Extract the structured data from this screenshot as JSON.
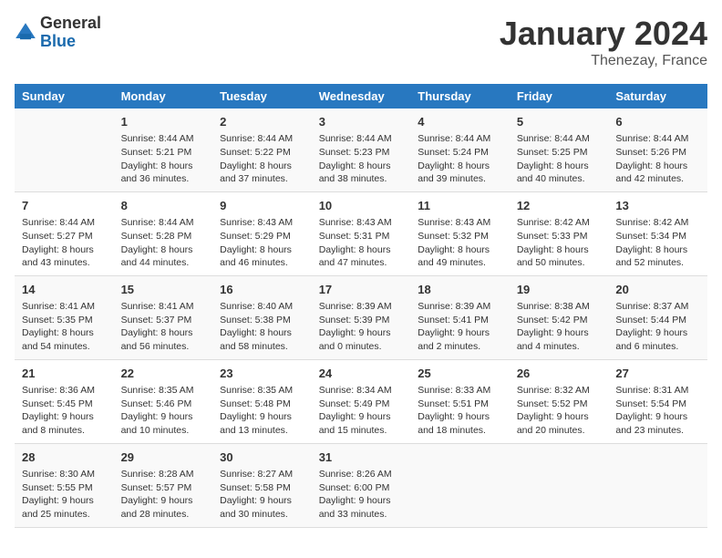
{
  "header": {
    "logo_general": "General",
    "logo_blue": "Blue",
    "month_title": "January 2024",
    "location": "Thenezay, France"
  },
  "weekdays": [
    "Sunday",
    "Monday",
    "Tuesday",
    "Wednesday",
    "Thursday",
    "Friday",
    "Saturday"
  ],
  "weeks": [
    [
      {
        "day": "",
        "sunrise": "",
        "sunset": "",
        "daylight": ""
      },
      {
        "day": "1",
        "sunrise": "Sunrise: 8:44 AM",
        "sunset": "Sunset: 5:21 PM",
        "daylight": "Daylight: 8 hours and 36 minutes."
      },
      {
        "day": "2",
        "sunrise": "Sunrise: 8:44 AM",
        "sunset": "Sunset: 5:22 PM",
        "daylight": "Daylight: 8 hours and 37 minutes."
      },
      {
        "day": "3",
        "sunrise": "Sunrise: 8:44 AM",
        "sunset": "Sunset: 5:23 PM",
        "daylight": "Daylight: 8 hours and 38 minutes."
      },
      {
        "day": "4",
        "sunrise": "Sunrise: 8:44 AM",
        "sunset": "Sunset: 5:24 PM",
        "daylight": "Daylight: 8 hours and 39 minutes."
      },
      {
        "day": "5",
        "sunrise": "Sunrise: 8:44 AM",
        "sunset": "Sunset: 5:25 PM",
        "daylight": "Daylight: 8 hours and 40 minutes."
      },
      {
        "day": "6",
        "sunrise": "Sunrise: 8:44 AM",
        "sunset": "Sunset: 5:26 PM",
        "daylight": "Daylight: 8 hours and 42 minutes."
      }
    ],
    [
      {
        "day": "7",
        "sunrise": "Sunrise: 8:44 AM",
        "sunset": "Sunset: 5:27 PM",
        "daylight": "Daylight: 8 hours and 43 minutes."
      },
      {
        "day": "8",
        "sunrise": "Sunrise: 8:44 AM",
        "sunset": "Sunset: 5:28 PM",
        "daylight": "Daylight: 8 hours and 44 minutes."
      },
      {
        "day": "9",
        "sunrise": "Sunrise: 8:43 AM",
        "sunset": "Sunset: 5:29 PM",
        "daylight": "Daylight: 8 hours and 46 minutes."
      },
      {
        "day": "10",
        "sunrise": "Sunrise: 8:43 AM",
        "sunset": "Sunset: 5:31 PM",
        "daylight": "Daylight: 8 hours and 47 minutes."
      },
      {
        "day": "11",
        "sunrise": "Sunrise: 8:43 AM",
        "sunset": "Sunset: 5:32 PM",
        "daylight": "Daylight: 8 hours and 49 minutes."
      },
      {
        "day": "12",
        "sunrise": "Sunrise: 8:42 AM",
        "sunset": "Sunset: 5:33 PM",
        "daylight": "Daylight: 8 hours and 50 minutes."
      },
      {
        "day": "13",
        "sunrise": "Sunrise: 8:42 AM",
        "sunset": "Sunset: 5:34 PM",
        "daylight": "Daylight: 8 hours and 52 minutes."
      }
    ],
    [
      {
        "day": "14",
        "sunrise": "Sunrise: 8:41 AM",
        "sunset": "Sunset: 5:35 PM",
        "daylight": "Daylight: 8 hours and 54 minutes."
      },
      {
        "day": "15",
        "sunrise": "Sunrise: 8:41 AM",
        "sunset": "Sunset: 5:37 PM",
        "daylight": "Daylight: 8 hours and 56 minutes."
      },
      {
        "day": "16",
        "sunrise": "Sunrise: 8:40 AM",
        "sunset": "Sunset: 5:38 PM",
        "daylight": "Daylight: 8 hours and 58 minutes."
      },
      {
        "day": "17",
        "sunrise": "Sunrise: 8:39 AM",
        "sunset": "Sunset: 5:39 PM",
        "daylight": "Daylight: 9 hours and 0 minutes."
      },
      {
        "day": "18",
        "sunrise": "Sunrise: 8:39 AM",
        "sunset": "Sunset: 5:41 PM",
        "daylight": "Daylight: 9 hours and 2 minutes."
      },
      {
        "day": "19",
        "sunrise": "Sunrise: 8:38 AM",
        "sunset": "Sunset: 5:42 PM",
        "daylight": "Daylight: 9 hours and 4 minutes."
      },
      {
        "day": "20",
        "sunrise": "Sunrise: 8:37 AM",
        "sunset": "Sunset: 5:44 PM",
        "daylight": "Daylight: 9 hours and 6 minutes."
      }
    ],
    [
      {
        "day": "21",
        "sunrise": "Sunrise: 8:36 AM",
        "sunset": "Sunset: 5:45 PM",
        "daylight": "Daylight: 9 hours and 8 minutes."
      },
      {
        "day": "22",
        "sunrise": "Sunrise: 8:35 AM",
        "sunset": "Sunset: 5:46 PM",
        "daylight": "Daylight: 9 hours and 10 minutes."
      },
      {
        "day": "23",
        "sunrise": "Sunrise: 8:35 AM",
        "sunset": "Sunset: 5:48 PM",
        "daylight": "Daylight: 9 hours and 13 minutes."
      },
      {
        "day": "24",
        "sunrise": "Sunrise: 8:34 AM",
        "sunset": "Sunset: 5:49 PM",
        "daylight": "Daylight: 9 hours and 15 minutes."
      },
      {
        "day": "25",
        "sunrise": "Sunrise: 8:33 AM",
        "sunset": "Sunset: 5:51 PM",
        "daylight": "Daylight: 9 hours and 18 minutes."
      },
      {
        "day": "26",
        "sunrise": "Sunrise: 8:32 AM",
        "sunset": "Sunset: 5:52 PM",
        "daylight": "Daylight: 9 hours and 20 minutes."
      },
      {
        "day": "27",
        "sunrise": "Sunrise: 8:31 AM",
        "sunset": "Sunset: 5:54 PM",
        "daylight": "Daylight: 9 hours and 23 minutes."
      }
    ],
    [
      {
        "day": "28",
        "sunrise": "Sunrise: 8:30 AM",
        "sunset": "Sunset: 5:55 PM",
        "daylight": "Daylight: 9 hours and 25 minutes."
      },
      {
        "day": "29",
        "sunrise": "Sunrise: 8:28 AM",
        "sunset": "Sunset: 5:57 PM",
        "daylight": "Daylight: 9 hours and 28 minutes."
      },
      {
        "day": "30",
        "sunrise": "Sunrise: 8:27 AM",
        "sunset": "Sunset: 5:58 PM",
        "daylight": "Daylight: 9 hours and 30 minutes."
      },
      {
        "day": "31",
        "sunrise": "Sunrise: 8:26 AM",
        "sunset": "Sunset: 6:00 PM",
        "daylight": "Daylight: 9 hours and 33 minutes."
      },
      {
        "day": "",
        "sunrise": "",
        "sunset": "",
        "daylight": ""
      },
      {
        "day": "",
        "sunrise": "",
        "sunset": "",
        "daylight": ""
      },
      {
        "day": "",
        "sunrise": "",
        "sunset": "",
        "daylight": ""
      }
    ]
  ]
}
